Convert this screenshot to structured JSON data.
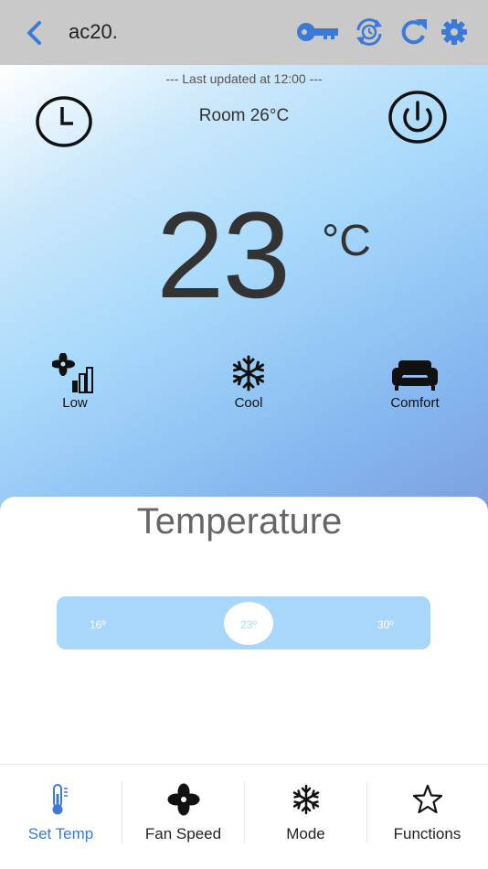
{
  "header": {
    "title": "ac20.",
    "icons": [
      "back-arrow-icon",
      "key-icon",
      "timer-sync-icon",
      "refresh-icon",
      "gear-icon"
    ],
    "accent_color": "#3b7ad6"
  },
  "status": {
    "last_updated": "--- Last updated at 12:00 ---",
    "room": "Room 26°C",
    "set_temp": "23",
    "unit": "°C",
    "fan_label": "Low",
    "mode_label": "Cool",
    "preset_label": "Comfort"
  },
  "temperature_panel": {
    "title": "Temperature",
    "min_label": "16º",
    "max_label": "30º",
    "current_label": "23º",
    "min": 16,
    "max": 30,
    "value": 23
  },
  "bottom_nav": {
    "tabs": [
      {
        "label": "Set Temp",
        "icon": "thermometer-icon",
        "active": true
      },
      {
        "label": "Fan Speed",
        "icon": "fan-icon",
        "active": false
      },
      {
        "label": "Mode",
        "icon": "snowflake-icon",
        "active": false
      },
      {
        "label": "Functions",
        "icon": "star-icon",
        "active": false
      }
    ]
  }
}
